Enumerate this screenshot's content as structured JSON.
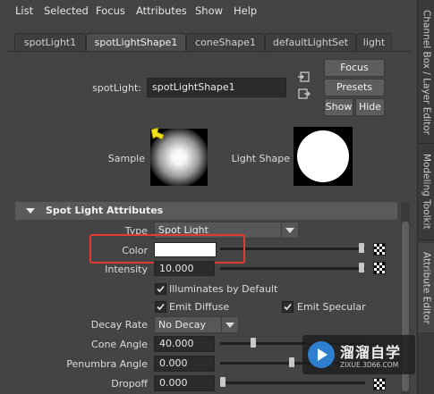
{
  "menu": [
    "List",
    "Selected",
    "Focus",
    "Attributes",
    "Show",
    "Help"
  ],
  "side_tabs": [
    "Channel Box / Layer Editor",
    "Modeling Toolkit",
    "Attribute Editor"
  ],
  "tabs": [
    "spotLight1",
    "spotLightShape1",
    "coneShape1",
    "defaultLightSet",
    "light"
  ],
  "active_tab": "spotLightShape1",
  "node": {
    "label": "spotLight:",
    "value": "spotLightShape1"
  },
  "buttons": {
    "focus": "Focus",
    "presets": "Presets",
    "show": "Show",
    "hide": "Hide"
  },
  "previews": {
    "sample_label": "Sample",
    "light_shape_label": "Light Shape"
  },
  "section": {
    "title": "Spot Light Attributes"
  },
  "attrs": {
    "type_label": "Type",
    "type_value": "Spot Light",
    "color_label": "Color",
    "color_value": "#ffffff",
    "intensity_label": "Intensity",
    "intensity_value": "10.000",
    "illuminates_label": "Illuminates by Default",
    "emit_diffuse_label": "Emit Diffuse",
    "emit_specular_label": "Emit Specular",
    "decay_label": "Decay Rate",
    "decay_value": "No Decay",
    "cone_label": "Cone Angle",
    "cone_value": "40.000",
    "penumbra_label": "Penumbra Angle",
    "penumbra_value": "0.000",
    "dropoff_label": "Dropoff",
    "dropoff_value": "0.000"
  },
  "watermark": {
    "cn": "溜溜自学",
    "url": "ZIXUE.3D66.COM"
  },
  "highlight_color": "#e53b2e"
}
